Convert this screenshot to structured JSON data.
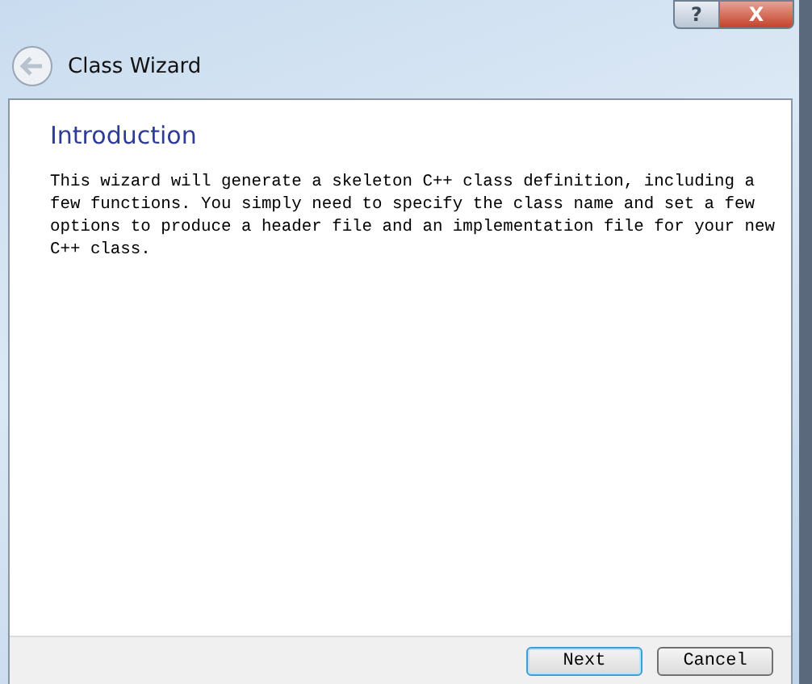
{
  "window": {
    "title": "Class Wizard"
  },
  "title_buttons": [
    {
      "kind": "help",
      "label": "?"
    },
    {
      "kind": "close",
      "label": "X"
    }
  ],
  "page": {
    "heading": "Introduction",
    "text": "This wizard will generate a skeleton C++ class definition, including a few functions. You simply need to specify the class name and set a few options to produce a header file and an implementation file for your new C++ class."
  },
  "buttons": [
    {
      "label": "Next",
      "selected": true
    },
    {
      "label": "Cancel",
      "selected": false
    }
  ]
}
